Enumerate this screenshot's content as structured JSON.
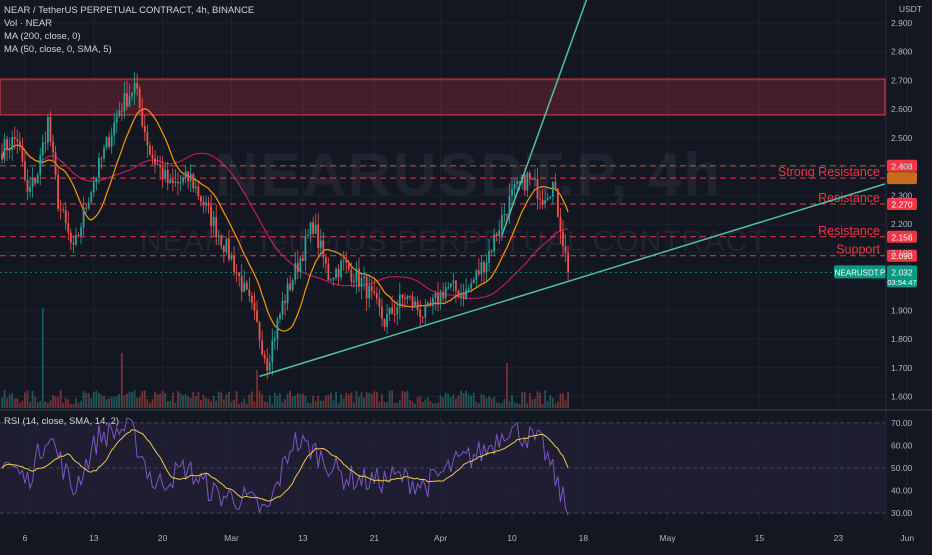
{
  "legend": {
    "title": "NEAR / TetherUS PERPETUAL CONTRACT, 4h, BINANCE",
    "vol": "Vol · NEAR",
    "ma200": "MA (200, close, 0)",
    "ma50": "MA (50, close, 0, SMA, 5)",
    "rsi": "RSI (14, close, SMA, 14, 2)"
  },
  "watermark": {
    "symbol": "NEARUSDT.P, 4h",
    "name": "NEAR / TetherUS PERPETUAL CONTRACT"
  },
  "axis_unit": "USDT",
  "colors": {
    "background": "#131722",
    "resistance_line": "#f23645",
    "trendline": "#4fc3a1",
    "ma_orange": "#ff9800",
    "ma_red": "#c2185b",
    "rsi_line": "#7e57c2",
    "rsi_ma": "#f2c94c",
    "up": "#26a69a",
    "down": "#ef5350",
    "label_green": "#089981",
    "label_orange": "#c96b1e"
  },
  "chart_data": [
    {
      "type": "candlestick",
      "ylim": [
        1.56,
        2.98
      ],
      "y_ticks": [
        "2.900",
        "2.800",
        "2.700",
        "2.600",
        "2.500",
        "2.400",
        "2.300",
        "2.200",
        "2.100",
        "1.900",
        "1.800",
        "1.700",
        "1.600"
      ],
      "y_tick_values": [
        2.9,
        2.8,
        2.7,
        2.6,
        2.5,
        2.4,
        2.3,
        2.2,
        2.1,
        1.9,
        1.8,
        1.7,
        1.6
      ],
      "x_ticks": [
        "6",
        "13",
        "20",
        "Mar",
        "13",
        "21",
        "Apr",
        "10",
        "18",
        "May",
        "15",
        "23",
        "Jun"
      ],
      "resistance_zone": [
        2.58,
        2.705
      ],
      "levels": [
        {
          "value": 2.403,
          "label": "2.403",
          "annotation": ""
        },
        {
          "value": 2.36,
          "label": "",
          "annotation": "Strong Resistance"
        },
        {
          "value": 2.27,
          "label": "2.270",
          "annotation": "Resistance"
        },
        {
          "value": 2.156,
          "label": "2.156",
          "annotation": "Resistance"
        },
        {
          "value": 2.09,
          "label": "2.090",
          "annotation": "Support"
        }
      ],
      "price_label": {
        "symbol": "NEARUSDT.P",
        "value": "2.032",
        "timer": "03:54:47"
      },
      "key_points": [
        {
          "x": 0,
          "y": 2.46
        },
        {
          "x": 6,
          "y": 2.5
        },
        {
          "x": 10,
          "y": 2.3
        },
        {
          "x": 14,
          "y": 2.38
        },
        {
          "x": 18,
          "y": 2.56
        },
        {
          "x": 22,
          "y": 2.28
        },
        {
          "x": 28,
          "y": 2.1
        },
        {
          "x": 34,
          "y": 2.3
        },
        {
          "x": 40,
          "y": 2.45
        },
        {
          "x": 46,
          "y": 2.6
        },
        {
          "x": 52,
          "y": 2.68
        },
        {
          "x": 58,
          "y": 2.45
        },
        {
          "x": 66,
          "y": 2.33
        },
        {
          "x": 74,
          "y": 2.36
        },
        {
          "x": 82,
          "y": 2.22
        },
        {
          "x": 90,
          "y": 2.08
        },
        {
          "x": 98,
          "y": 1.9
        },
        {
          "x": 104,
          "y": 1.72
        },
        {
          "x": 110,
          "y": 1.92
        },
        {
          "x": 116,
          "y": 2.06
        },
        {
          "x": 122,
          "y": 2.2
        },
        {
          "x": 128,
          "y": 2.02
        },
        {
          "x": 134,
          "y": 2.06
        },
        {
          "x": 142,
          "y": 1.99
        },
        {
          "x": 150,
          "y": 1.86
        },
        {
          "x": 158,
          "y": 1.95
        },
        {
          "x": 166,
          "y": 1.88
        },
        {
          "x": 174,
          "y": 1.98
        },
        {
          "x": 182,
          "y": 1.96
        },
        {
          "x": 190,
          "y": 2.08
        },
        {
          "x": 196,
          "y": 2.22
        },
        {
          "x": 200,
          "y": 2.3
        },
        {
          "x": 206,
          "y": 2.36
        },
        {
          "x": 212,
          "y": 2.3
        },
        {
          "x": 216,
          "y": 2.34
        },
        {
          "x": 219,
          "y": 2.2
        },
        {
          "x": 222,
          "y": 2.032
        }
      ]
    },
    {
      "type": "line",
      "title": "RSI",
      "ylim": [
        26,
        73
      ],
      "y_ticks": [
        "70.00",
        "60.00",
        "50.00",
        "40.00",
        "30.00"
      ],
      "y_tick_values": [
        70,
        60,
        50,
        40,
        30
      ],
      "band": [
        30,
        70
      ],
      "key_points": [
        {
          "x": 0,
          "y": 55
        },
        {
          "x": 10,
          "y": 44
        },
        {
          "x": 18,
          "y": 66
        },
        {
          "x": 28,
          "y": 40
        },
        {
          "x": 38,
          "y": 64
        },
        {
          "x": 50,
          "y": 68
        },
        {
          "x": 60,
          "y": 42
        },
        {
          "x": 72,
          "y": 50
        },
        {
          "x": 84,
          "y": 38
        },
        {
          "x": 96,
          "y": 36
        },
        {
          "x": 104,
          "y": 30
        },
        {
          "x": 114,
          "y": 62
        },
        {
          "x": 122,
          "y": 58
        },
        {
          "x": 134,
          "y": 46
        },
        {
          "x": 146,
          "y": 44
        },
        {
          "x": 156,
          "y": 46
        },
        {
          "x": 166,
          "y": 42
        },
        {
          "x": 178,
          "y": 52
        },
        {
          "x": 190,
          "y": 58
        },
        {
          "x": 198,
          "y": 68
        },
        {
          "x": 206,
          "y": 64
        },
        {
          "x": 212,
          "y": 60
        },
        {
          "x": 218,
          "y": 42
        },
        {
          "x": 222,
          "y": 30
        }
      ]
    }
  ]
}
